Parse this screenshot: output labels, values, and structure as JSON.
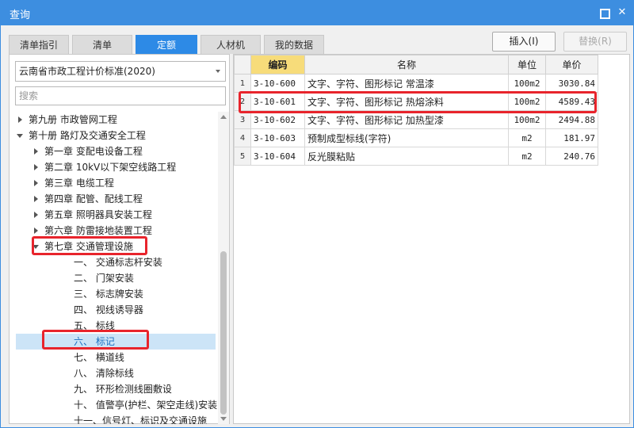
{
  "window": {
    "title": "查询"
  },
  "tabs": [
    {
      "label": "清单指引",
      "active": false
    },
    {
      "label": "清单",
      "active": false
    },
    {
      "label": "定额",
      "active": true
    },
    {
      "label": "人材机",
      "active": false
    },
    {
      "label": "我的数据",
      "active": false
    }
  ],
  "buttons": {
    "insert": "插入(I)",
    "replace": "替换(R)"
  },
  "left": {
    "standard_select": "云南省市政工程计价标准(2020)",
    "search_placeholder": "搜索",
    "tree": [
      {
        "label": "第九册 市政管网工程",
        "level": 0,
        "caret": "right"
      },
      {
        "label": "第十册 路灯及交通安全工程",
        "level": 0,
        "caret": "down"
      },
      {
        "label": "第一章 变配电设备工程",
        "level": 1,
        "caret": "right"
      },
      {
        "label": "第二章 10kV以下架空线路工程",
        "level": 1,
        "caret": "right"
      },
      {
        "label": "第三章 电缆工程",
        "level": 1,
        "caret": "right"
      },
      {
        "label": "第四章 配管、配线工程",
        "level": 1,
        "caret": "right"
      },
      {
        "label": "第五章 照明器具安装工程",
        "level": 1,
        "caret": "right"
      },
      {
        "label": "第六章 防雷接地装置工程",
        "level": 1,
        "caret": "right"
      },
      {
        "label": "第七章 交通管理设施",
        "level": 1,
        "caret": "down"
      },
      {
        "label": "一、 交通标志杆安装",
        "level": 2,
        "caret": "none"
      },
      {
        "label": "二、 门架安装",
        "level": 2,
        "caret": "none"
      },
      {
        "label": "三、 标志牌安装",
        "level": 2,
        "caret": "none"
      },
      {
        "label": "四、 视线诱导器",
        "level": 2,
        "caret": "none"
      },
      {
        "label": "五、 标线",
        "level": 2,
        "caret": "none"
      },
      {
        "label": "六、 标记",
        "level": 2,
        "caret": "none",
        "selected": true
      },
      {
        "label": "七、 横道线",
        "level": 2,
        "caret": "none"
      },
      {
        "label": "八、 清除标线",
        "level": 2,
        "caret": "none"
      },
      {
        "label": "九、 环形检测线圈敷设",
        "level": 2,
        "caret": "none"
      },
      {
        "label": "十、 值警亭(护栏、架空走线)安装",
        "level": 2,
        "caret": "none"
      },
      {
        "label": "十一、信号灯、标识及交通设施",
        "level": 2,
        "caret": "none"
      }
    ]
  },
  "grid": {
    "columns": [
      "编码",
      "名称",
      "单位",
      "单价"
    ],
    "rows": [
      {
        "n": "1",
        "code": "3-10-600",
        "name": "文字、字符、图形标记 常温漆",
        "unit": "100m2",
        "price": "3030.84"
      },
      {
        "n": "2",
        "code": "3-10-601",
        "name": "文字、字符、图形标记 热熔涂料",
        "unit": "100m2",
        "price": "4589.43"
      },
      {
        "n": "3",
        "code": "3-10-602",
        "name": "文字、字符、图形标记 加热型漆",
        "unit": "100m2",
        "price": "2494.88"
      },
      {
        "n": "4",
        "code": "3-10-603",
        "name": "预制成型标线(字符)",
        "unit": "m2",
        "price": "181.97"
      },
      {
        "n": "5",
        "code": "3-10-604",
        "name": "反光膜粘贴",
        "unit": "m2",
        "price": "240.76"
      }
    ]
  },
  "colors": {
    "titlebar": "#3d8ee0",
    "active_tab": "#2d8ae6",
    "highlight": "#e8242c",
    "header_code": "#f7dc7a"
  }
}
